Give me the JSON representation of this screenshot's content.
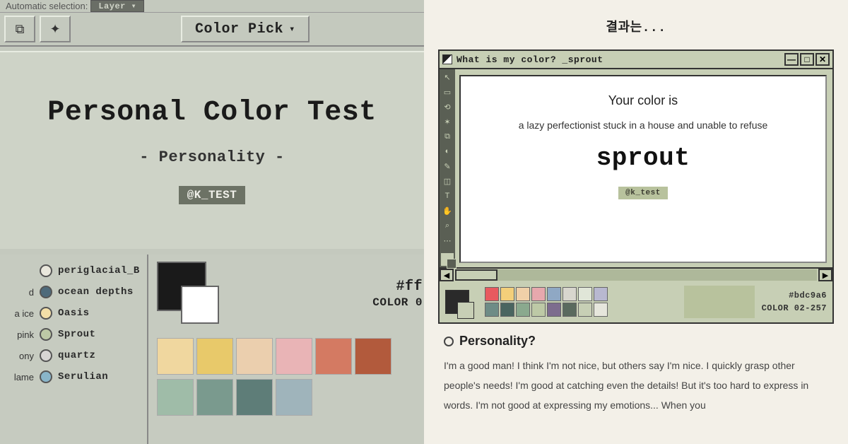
{
  "left": {
    "topbar": {
      "auto_selection": "Automatic selection:",
      "layer_dropdown": "Layer ▾"
    },
    "colorpick_label": "Color Pick",
    "title": "Personal Color Test",
    "subtitle": "- Personality -",
    "tag": "@K_TEST",
    "color_list": [
      {
        "lead": "",
        "label": "periglacial_B",
        "color": "#e9e7dc"
      },
      {
        "lead": "d",
        "label": "ocean depths",
        "color": "#4e6a7a"
      },
      {
        "lead": "a ice",
        "label": "Oasis",
        "color": "#f3dfa8"
      },
      {
        "lead": "pink",
        "label": "Sprout",
        "color": "#bdc9a6"
      },
      {
        "lead": "ony",
        "label": "quartz",
        "color": "#d8d6d4"
      },
      {
        "lead": "lame",
        "label": "Serulian",
        "color": "#89b5c9"
      }
    ],
    "hex_text": "#ff",
    "color_code": "COLOR 0",
    "swatches1": [
      "#f0d79f",
      "#e8c96a",
      "#ebcfae",
      "#e9b4b6",
      "#d47a62",
      "#b25a3c"
    ],
    "swatches2": [
      "#9fbca8",
      "#7a9a8e",
      "#5e7d78",
      "#9fb4bb"
    ]
  },
  "right": {
    "heading": "결과는...",
    "window_title": "What is my color? _sprout",
    "your_color_is": "Your color is",
    "description": "a lazy perfectionist stuck in a house and unable to refuse",
    "color_name": "sprout",
    "chip": "@k_test",
    "hex": "#bdc9a6",
    "color_code": "COLOR 02-257",
    "mini_palette": [
      "#e85a5f",
      "#f3cf7a",
      "#f0d0a8",
      "#e7a8ad",
      "#8fa8c4",
      "#d8d6ce",
      "#e0e6d8",
      "#b8b8d0",
      "#6e8c86",
      "#4a6560",
      "#8aa98e",
      "#bdc9a6",
      "#7d6c8e",
      "#5a6a5e",
      "#c7cfb5",
      "#e6e6dc"
    ],
    "personality_heading": "Personality?",
    "personality_body": "I'm a good man! I think I'm not nice, but others say I'm nice. I quickly grasp other people's needs! I'm good at catching even the details! But it's too hard to express in words. I'm not good at expressing my emotions... When you"
  }
}
